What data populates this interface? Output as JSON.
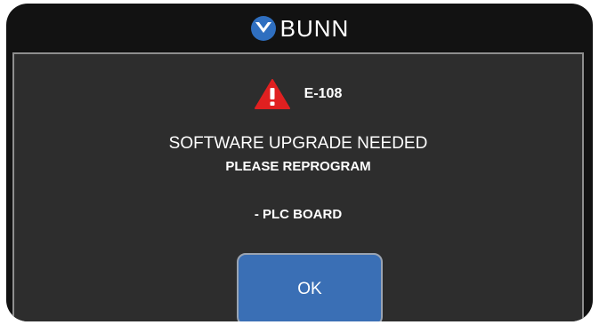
{
  "header": {
    "brand": "BUNN",
    "logo_icon": "bunn-logo-icon"
  },
  "dialog": {
    "warning_icon": "warning-triangle-icon",
    "error_code": "E-108",
    "title": "SOFTWARE UPGRADE NEEDED",
    "subtitle": "PLEASE REPROGRAM",
    "component": "- PLC BOARD",
    "ok_label": "OK"
  },
  "colors": {
    "frame": "#121212",
    "panel": "#2d2d2d",
    "panel_border": "#8e8e8e",
    "button": "#3a6fb5",
    "warning": "#e02020",
    "logo_blue": "#2f6fc0"
  }
}
